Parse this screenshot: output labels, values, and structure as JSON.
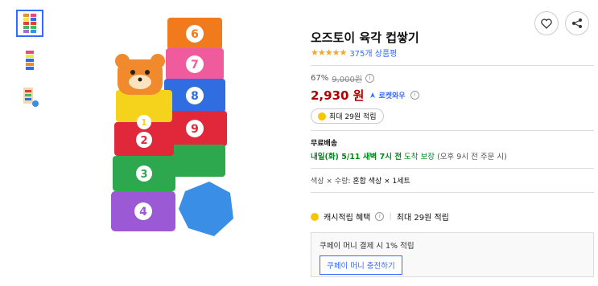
{
  "product": {
    "title": "오즈토이 육각 컵쌓기",
    "rating_stars": "★★★★★",
    "review_count": "375개 상품평"
  },
  "price": {
    "discount": "67%",
    "original": "9,000원",
    "sale": "2,930 원",
    "rocket_label": "로켓와우"
  },
  "reward": {
    "label": "최대 29원 적립"
  },
  "shipping": {
    "label": "무료배송",
    "date": "내일(화) 5/11 새벽 7시 전",
    "guarantee": "도착 보장",
    "note": "(오후 9시 전 주문 시)"
  },
  "option": {
    "key": "색상 × 수량",
    "value": "혼합 색상 × 1세트"
  },
  "cash": {
    "label": "캐시적립 혜택",
    "value": "최대 29원 적립"
  },
  "coupay": {
    "text": "쿠페이 머니 결제 시 1% 적립",
    "button": "쿠페이 머니 충전하기"
  },
  "cups": [
    "4",
    "3",
    "2",
    "1",
    "9",
    "8",
    "7",
    "6"
  ],
  "colors": {
    "accent": "#346aff",
    "price": "#ae0000",
    "green": "#00891a"
  }
}
